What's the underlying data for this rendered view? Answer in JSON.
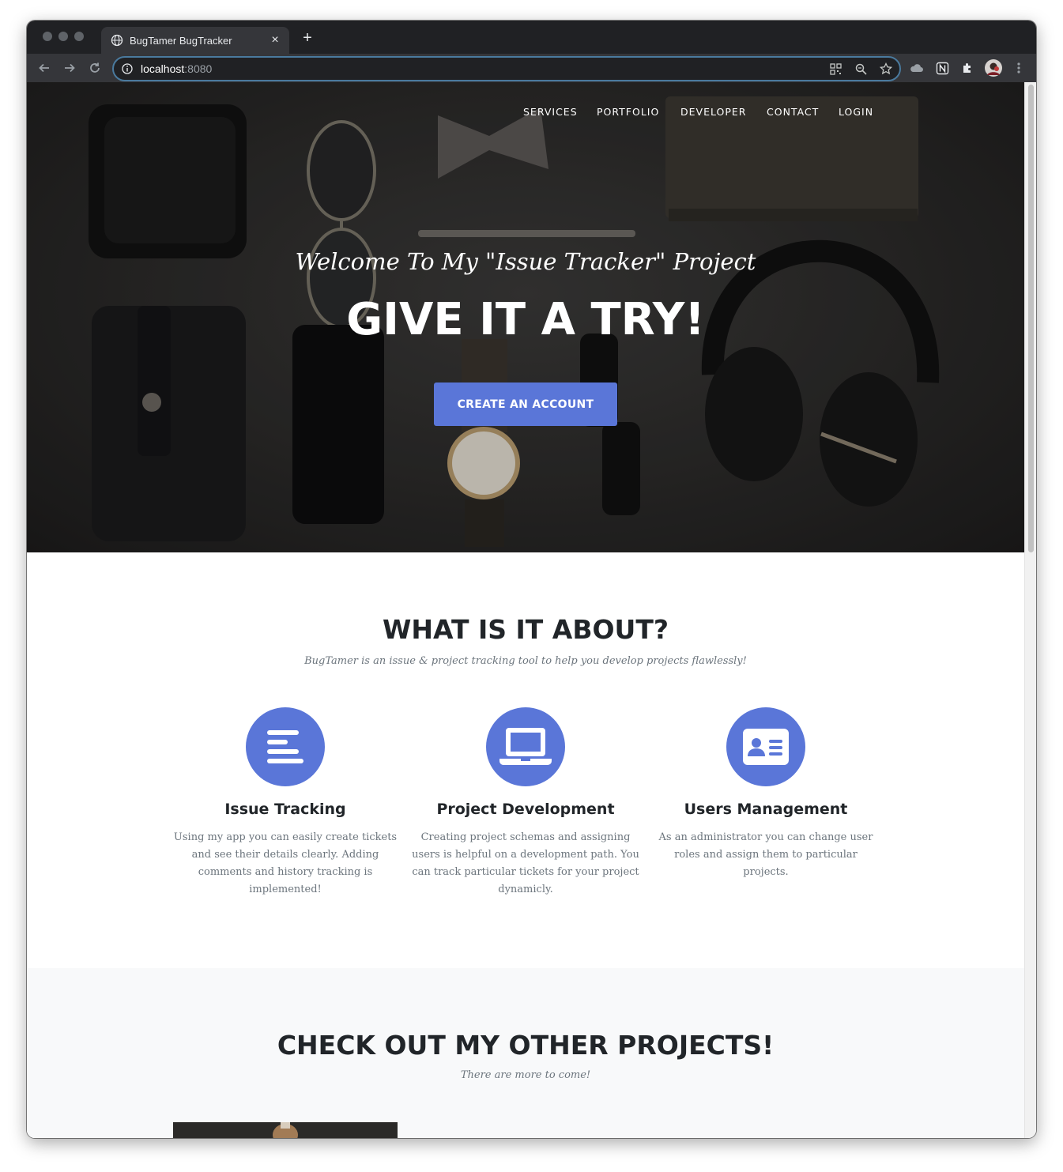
{
  "browser": {
    "tab_title": "BugTamer BugTracker",
    "tab_close": "×",
    "new_tab": "+",
    "url_host": "localhost",
    "url_port": ":8080"
  },
  "nav": {
    "items": [
      "SERVICES",
      "PORTFOLIO",
      "DEVELOPER",
      "CONTACT",
      "LOGIN"
    ]
  },
  "hero": {
    "subtitle": "Welcome To My \"Issue Tracker\" Project",
    "title": "GIVE IT A TRY!",
    "cta_label": "CREATE AN ACCOUNT"
  },
  "about": {
    "title": "WHAT IS IT ABOUT?",
    "subtitle": "BugTamer is an issue & project tracking tool to help you develop projects flawlessly!",
    "services": [
      {
        "icon": "align-left-icon",
        "heading": "Issue Tracking",
        "text": "Using my app you can easily create tickets and see their details clearly. Adding comments and history tracking is implemented!"
      },
      {
        "icon": "laptop-icon",
        "heading": "Project Development",
        "text": "Creating project schemas and assigning users is helpful on a development path. You can track particular tickets for your project dynamicly."
      },
      {
        "icon": "id-card-icon",
        "heading": "Users Management",
        "text": "As an administrator you can change user roles and assign them to particular projects."
      }
    ]
  },
  "portfolio": {
    "title": "CHECK OUT MY OTHER PROJECTS!",
    "subtitle": "There are more to come!"
  },
  "colors": {
    "accent": "#5a76d8",
    "heading": "#212529",
    "muted": "#6c757d",
    "section_bg": "#f8f9fa"
  }
}
